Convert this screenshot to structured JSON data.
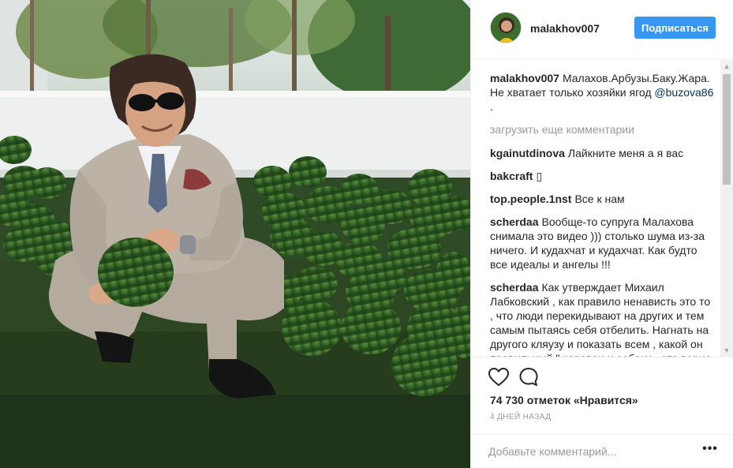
{
  "post": {
    "photo_icon": "post-photo",
    "author": {
      "username": "malakhov007",
      "avatar_icon": "avatar-photo",
      "follow_label": "Подписаться"
    },
    "caption": {
      "username": "malakhov007",
      "text": "Малахов.Арбузы.Баку.Жара. Не хватает только хозяйки ягод",
      "mention": "@buzova86",
      "suffix": " ."
    },
    "load_more_label": "загрузить еще комментарии",
    "comments": [
      {
        "username": "kgainutdinova",
        "text": "Лайкните меня а я вас"
      },
      {
        "username": "bakcraft",
        "text": "▯"
      },
      {
        "username": "top.people.1nst",
        "text": "Все к нам"
      },
      {
        "username": "scherdaa",
        "text": "Вообще-то супруга Малахова снимала это видео ))) столько шума из-за ничего. И кудахчат и кудахчат. Как будто все идеалы и ангелы !!!"
      },
      {
        "username": "scherdaa",
        "text": "Как утверждает Михаил Лабковский , как правило ненависть это то , что люди перекидывают на других и тем самым пытаясь себя отбелить. Нагнать на другого кляузу и показать всем , какой он правильный \" караван и собаки - это верно ▯\""
      }
    ],
    "actions": {
      "like_icon": "heart-icon",
      "comment_icon": "comment-bubble-icon",
      "likes_text": "74 730 отметок «Нравится»",
      "time_text": "4 ДНЕЙ НАЗАД"
    },
    "add_comment": {
      "placeholder": "Добавьте комментарий...",
      "more_label": "•••"
    },
    "colors": {
      "accent": "#3897f0",
      "mention": "#003569",
      "muted": "#999999",
      "text": "#262626"
    }
  }
}
